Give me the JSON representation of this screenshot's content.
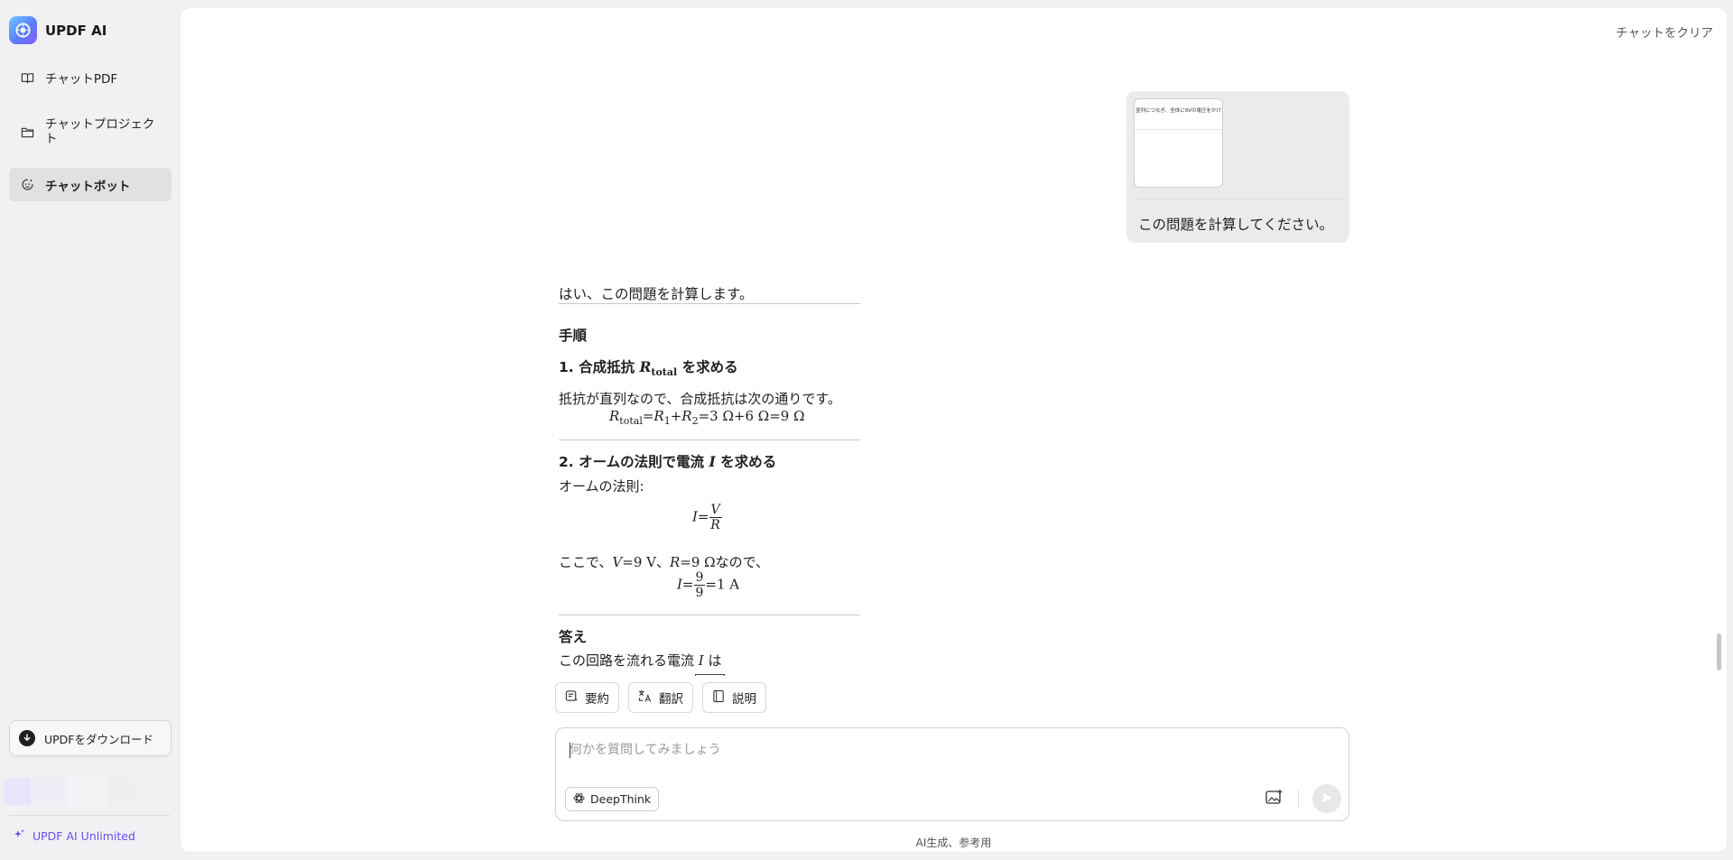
{
  "app": {
    "brand_name": "UPDF AI"
  },
  "sidebar": {
    "items": [
      {
        "label": "チャットPDF",
        "icon": "book-open-icon"
      },
      {
        "label": "チャットプロジェクト",
        "icon": "folder-icon"
      },
      {
        "label": "チャットボット",
        "icon": "chatbot-icon",
        "selected": true
      }
    ],
    "download_label": "UPDFをダウンロード",
    "unlimited_label": "UPDF AI Unlimited",
    "progress_colors": [
      "#e9e6fb",
      "#efeef7",
      "#f3f3f5",
      "#f1f1f3"
    ]
  },
  "header": {
    "clear_chat_label": "チャットをクリア"
  },
  "user_message": {
    "attachment_preview_text": "並列につなぎ、全体に9Vの電圧をかけた。",
    "text": "この問題を計算してください。"
  },
  "answer": {
    "intro": "はい、この問題を計算します。",
    "steps_heading": "手順",
    "step1": {
      "heading_prefix": "1. 合成抵抗",
      "heading_var": "R",
      "heading_sub": "total",
      "heading_suffix": "を求める",
      "body": "抵抗が直列なので、合成抵抗は次の通りです。",
      "formula": {
        "lhs_var": "R",
        "lhs_sub": "total",
        "r1_var": "R",
        "r1_sub": "1",
        "r2_var": "R",
        "r2_sub": "2",
        "rest": "=3 Ω+6 Ω=9 Ω"
      }
    },
    "step2": {
      "heading_prefix": "2. オームの法則で電流",
      "heading_var": "I",
      "heading_suffix": "を求める",
      "law_label": "オームの法則:",
      "law_lhs": "I=",
      "law_num": "V",
      "law_den": "R",
      "given_prefix": "ここで、",
      "given_v": "V",
      "given_v_value": "=9 V、",
      "given_r": "R",
      "given_r_value": "=9 Ω",
      "given_suffix": "なので、",
      "calc_lhs": "I=",
      "calc_num": "9",
      "calc_den": "9",
      "calc_result": "=1 A"
    },
    "answer_heading": "答え",
    "answer_prefix": "この回路を流れる電流",
    "answer_var": "I",
    "answer_suffix": "は"
  },
  "quick_actions": [
    {
      "label": "要約",
      "icon": "summarize-icon"
    },
    {
      "label": "翻訳",
      "icon": "translate-icon"
    },
    {
      "label": "説明",
      "icon": "explain-icon"
    }
  ],
  "composer": {
    "placeholder": "何かを質問してみましょう",
    "value": "",
    "deepthink_label": "DeepThink"
  },
  "footer_note": "AI生成、参考用",
  "colors": {
    "accent": "#6a4cf0",
    "selected_nav": "#e1e1e4",
    "user_bubble": "#ebebed"
  }
}
